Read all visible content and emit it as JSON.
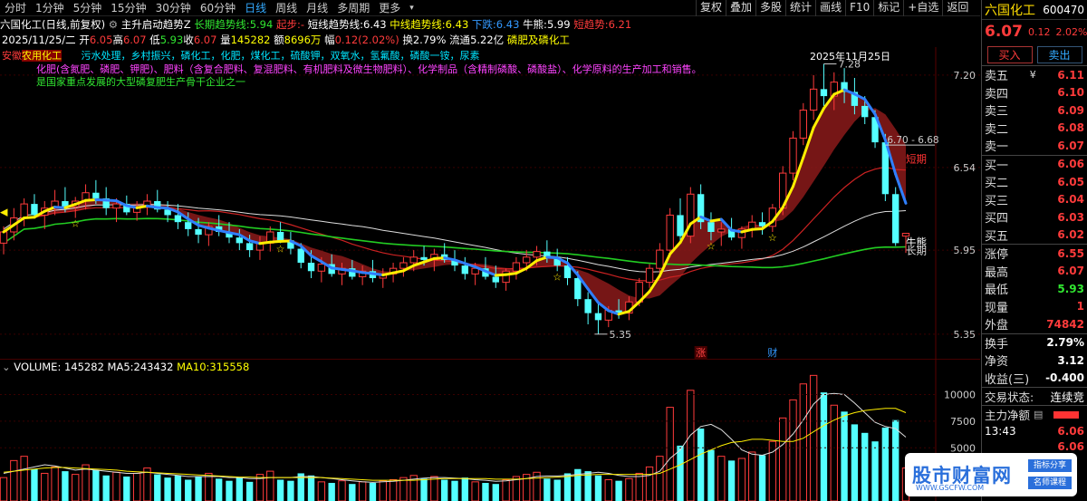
{
  "toolbar": {
    "periods": [
      "分时",
      "1分钟",
      "5分钟",
      "15分钟",
      "30分钟",
      "60分钟",
      "日线",
      "周线",
      "月线",
      "多周期",
      "更多"
    ],
    "selected_period": "日线",
    "right_buttons": [
      "复权",
      "叠加",
      "多股",
      "统计",
      "画线",
      "F10",
      "标记",
      "+自选",
      "返回"
    ]
  },
  "info1": {
    "stock": "六国化工(日线,前复权)",
    "indicator": "主升启动趋势Z",
    "long_trend_label": "长期趋势线:",
    "long_trend_val": "5.94",
    "start_label": "起步:",
    "start_val": "-",
    "short_trend_label": "短线趋势线:",
    "short_trend_val": "6.43",
    "mid_trend_label": "中线趋势线:",
    "mid_trend_val": "6.43",
    "down_label": "下跌:",
    "down_val": "6.43",
    "bull_label": "牛熊:",
    "bull_val": "5.99",
    "short_potential_label": "短趋势:",
    "short_potential_val": "6.21"
  },
  "info2": {
    "date": "2025/11/25/二",
    "open_label": "开",
    "open": "6.05",
    "high_label": "高",
    "high": "6.07",
    "low_label": "低",
    "low": "5.93",
    "close_label": "收",
    "close": "6.07",
    "vol_label": "量",
    "vol": "145282",
    "amount_label": "额",
    "amount": "8696万",
    "change_label": "幅",
    "change": "0.12(2.02%)",
    "turnover_label": "换",
    "turnover": "2.79%",
    "float_label": "流通",
    "float": "5.22亿",
    "sector": "磷肥及磷化工"
  },
  "info3": {
    "region": "安徽",
    "tag": "农用化工",
    "concepts": "污水处理，乡村振兴，磷化工，化肥，煤化工，硫酸钾，双氧水，氢氟酸，磷酸一铵，尿素",
    "business": "化肥(含氮肥、磷肥、钾肥)、肥料（含复合肥料、复混肥料、有机肥料及微生物肥料）、化学制品（含精制磷酸、磷酸盐）、化学原料的生产加工和销售。",
    "desc": "是国家重点发展的大型磷复肥生产骨干企业之一"
  },
  "chart_labels": {
    "date_marker": "2025年11月25日",
    "high_marker": "7.28",
    "low_marker": "5.35",
    "range_marker": "6.70 - 6.68",
    "short_label": "短期",
    "bull_label": "牛熊",
    "long_label": "长期",
    "event_zhang": "涨",
    "event_cai": "财"
  },
  "price_axis": [
    "7.20",
    "6.54",
    "5.95",
    "5.35"
  ],
  "volume_info": {
    "title": "VOLUME:",
    "volume": "145282",
    "ma5_label": "MA5:",
    "ma5": "243432",
    "ma10_label": "MA10:",
    "ma10": "315558"
  },
  "volume_axis": [
    "10000",
    "7500",
    "5000"
  ],
  "right_panel": {
    "name": "六国化工",
    "code": "600470",
    "price": "6.07",
    "change": "0.12",
    "change_pct": "2.02%",
    "buy_label": "买入",
    "sell_label": "卖出",
    "asks": [
      {
        "label": "卖五",
        "price": "6.11"
      },
      {
        "label": "卖四",
        "price": "6.10"
      },
      {
        "label": "卖三",
        "price": "6.09"
      },
      {
        "label": "卖二",
        "price": "6.08"
      },
      {
        "label": "卖一",
        "price": "6.07"
      }
    ],
    "ask_marker": "¥",
    "bids": [
      {
        "label": "买一",
        "price": "6.06"
      },
      {
        "label": "买二",
        "price": "6.05"
      },
      {
        "label": "买三",
        "price": "6.04"
      },
      {
        "label": "买四",
        "price": "6.03"
      },
      {
        "label": "买五",
        "price": "6.02"
      }
    ],
    "stats": [
      {
        "label": "涨停",
        "value": "6.55",
        "color": "red"
      },
      {
        "label": "最高",
        "value": "6.07",
        "color": "red"
      },
      {
        "label": "最低",
        "value": "5.93",
        "color": "green"
      },
      {
        "label": "现量",
        "value": "1",
        "color": "red"
      },
      {
        "label": "外盘",
        "value": "74842",
        "color": "red"
      }
    ],
    "stats2": [
      {
        "label": "换手",
        "value": "2.79%"
      },
      {
        "label": "净资",
        "value": "3.12"
      },
      {
        "label": "收益(三)",
        "value": "-0.400"
      }
    ],
    "trade_status_label": "交易状态:",
    "trade_status": "连续竞",
    "main_flow_label": "主力净额",
    "time": "13:43",
    "tick1": "6.06",
    "tick2": "6.06"
  },
  "watermark": {
    "main": "股市财富网",
    "sub": "WWW.GSCFW.COM",
    "tag1": "指标分享",
    "tag2": "名师课程"
  },
  "chart_data": {
    "type": "candlestick",
    "ylim": [
      5.2,
      7.4
    ],
    "candles": [
      [
        6.0,
        6.12,
        5.92,
        6.08
      ],
      [
        6.08,
        6.25,
        6.02,
        6.18
      ],
      [
        6.18,
        6.32,
        6.12,
        6.28
      ],
      [
        6.28,
        6.35,
        6.18,
        6.2
      ],
      [
        6.2,
        6.3,
        6.1,
        6.25
      ],
      [
        6.25,
        6.38,
        6.2,
        6.3
      ],
      [
        6.3,
        6.4,
        6.22,
        6.26
      ],
      [
        6.26,
        6.33,
        6.18,
        6.3
      ],
      [
        6.3,
        6.42,
        6.24,
        6.36
      ],
      [
        6.36,
        6.45,
        6.28,
        6.32
      ],
      [
        6.32,
        6.4,
        6.2,
        6.25
      ],
      [
        6.25,
        6.32,
        6.15,
        6.28
      ],
      [
        6.28,
        6.34,
        6.2,
        6.22
      ],
      [
        6.22,
        6.3,
        6.16,
        6.26
      ],
      [
        6.26,
        6.35,
        6.2,
        6.3
      ],
      [
        6.3,
        6.38,
        6.22,
        6.24
      ],
      [
        6.24,
        6.3,
        6.15,
        6.2
      ],
      [
        6.2,
        6.28,
        6.1,
        6.15
      ],
      [
        6.15,
        6.22,
        6.05,
        6.1
      ],
      [
        6.1,
        6.18,
        6.0,
        6.06
      ],
      [
        6.06,
        6.15,
        5.98,
        6.12
      ],
      [
        6.12,
        6.2,
        6.05,
        6.08
      ],
      [
        6.08,
        6.15,
        6.0,
        6.04
      ],
      [
        6.04,
        6.1,
        5.95,
        6.0
      ],
      [
        6.0,
        6.06,
        5.9,
        5.95
      ],
      [
        5.95,
        6.05,
        5.88,
        6.0
      ],
      [
        6.0,
        6.12,
        5.94,
        6.08
      ],
      [
        6.08,
        6.15,
        6.0,
        6.02
      ],
      [
        6.02,
        6.08,
        5.92,
        5.96
      ],
      [
        5.96,
        6.0,
        5.82,
        5.86
      ],
      [
        5.86,
        5.95,
        5.75,
        5.8
      ],
      [
        5.8,
        5.9,
        5.72,
        5.85
      ],
      [
        5.85,
        5.92,
        5.76,
        5.78
      ],
      [
        5.78,
        5.86,
        5.7,
        5.82
      ],
      [
        5.82,
        5.88,
        5.74,
        5.76
      ],
      [
        5.76,
        5.84,
        5.7,
        5.8
      ],
      [
        5.8,
        5.88,
        5.72,
        5.75
      ],
      [
        5.75,
        5.82,
        5.68,
        5.78
      ],
      [
        5.78,
        5.86,
        5.72,
        5.82
      ],
      [
        5.82,
        5.9,
        5.76,
        5.86
      ],
      [
        5.86,
        5.95,
        5.8,
        5.9
      ],
      [
        5.9,
        5.98,
        5.84,
        5.88
      ],
      [
        5.88,
        5.96,
        5.8,
        5.92
      ],
      [
        5.92,
        6.0,
        5.86,
        5.88
      ],
      [
        5.88,
        5.95,
        5.8,
        5.84
      ],
      [
        5.84,
        5.9,
        5.74,
        5.78
      ],
      [
        5.78,
        5.86,
        5.7,
        5.82
      ],
      [
        5.82,
        5.9,
        5.74,
        5.76
      ],
      [
        5.76,
        5.84,
        5.68,
        5.72
      ],
      [
        5.72,
        5.82,
        5.66,
        5.8
      ],
      [
        5.8,
        5.9,
        5.74,
        5.86
      ],
      [
        5.86,
        5.95,
        5.8,
        5.9
      ],
      [
        5.9,
        5.98,
        5.84,
        5.94
      ],
      [
        5.94,
        6.02,
        5.86,
        5.9
      ],
      [
        5.9,
        5.96,
        5.8,
        5.84
      ],
      [
        5.84,
        5.9,
        5.7,
        5.75
      ],
      [
        5.75,
        5.8,
        5.55,
        5.6
      ],
      [
        5.6,
        5.65,
        5.42,
        5.5
      ],
      [
        5.5,
        5.58,
        5.35,
        5.45
      ],
      [
        5.45,
        5.55,
        5.4,
        5.52
      ],
      [
        5.52,
        5.6,
        5.46,
        5.5
      ],
      [
        5.5,
        5.62,
        5.45,
        5.58
      ],
      [
        5.58,
        5.75,
        5.55,
        5.72
      ],
      [
        5.72,
        5.85,
        5.68,
        5.82
      ],
      [
        5.82,
        6.0,
        5.78,
        5.95
      ],
      [
        5.95,
        6.25,
        5.9,
        6.2
      ],
      [
        6.2,
        6.32,
        6.02,
        6.05
      ],
      [
        6.05,
        6.4,
        6.0,
        6.35
      ],
      [
        6.35,
        6.42,
        6.1,
        6.15
      ],
      [
        6.15,
        6.22,
        6.02,
        6.08
      ],
      [
        6.08,
        6.15,
        5.98,
        6.1
      ],
      [
        6.1,
        6.18,
        6.02,
        6.04
      ],
      [
        6.04,
        6.12,
        5.96,
        6.1
      ],
      [
        6.1,
        6.2,
        6.04,
        6.15
      ],
      [
        6.15,
        6.22,
        6.06,
        6.12
      ],
      [
        6.12,
        6.28,
        6.08,
        6.25
      ],
      [
        6.25,
        6.55,
        6.2,
        6.5
      ],
      [
        6.5,
        6.8,
        6.45,
        6.75
      ],
      [
        6.75,
        7.0,
        6.7,
        6.95
      ],
      [
        6.95,
        7.2,
        6.88,
        7.1
      ],
      [
        7.1,
        7.28,
        6.98,
        7.05
      ],
      [
        7.05,
        7.22,
        6.95,
        7.15
      ],
      [
        7.15,
        7.25,
        7.0,
        7.08
      ],
      [
        7.08,
        7.18,
        6.92,
        6.98
      ],
      [
        6.98,
        7.05,
        6.85,
        6.9
      ],
      [
        6.9,
        6.95,
        6.68,
        6.72
      ],
      [
        6.72,
        6.78,
        6.3,
        6.35
      ],
      [
        6.35,
        6.4,
        5.98,
        6.0
      ],
      [
        6.05,
        6.07,
        5.93,
        6.07
      ]
    ],
    "volume_ylim": [
      0,
      12000
    ],
    "volumes": [
      2200,
      3800,
      4200,
      3000,
      2600,
      3200,
      2800,
      2500,
      3400,
      2900,
      2400,
      2700,
      2300,
      2600,
      3100,
      2500,
      2200,
      2400,
      2000,
      2300,
      2600,
      2100,
      1900,
      2200,
      1800,
      2500,
      2800,
      2000,
      1900,
      2600,
      2400,
      1800,
      1700,
      1900,
      1600,
      1800,
      1700,
      1900,
      2000,
      2200,
      2400,
      2100,
      2300,
      2000,
      1900,
      2200,
      1800,
      1700,
      1600,
      2000,
      2300,
      2500,
      2700,
      2100,
      2000,
      2600,
      3000,
      2800,
      2400,
      2000,
      1900,
      2100,
      2600,
      3200,
      4200,
      8800,
      5200,
      10400,
      6800,
      4800,
      4200,
      3800,
      4000,
      4600,
      4300,
      5600,
      7800,
      9500,
      11000,
      11800,
      10200,
      9000,
      8400,
      7200,
      6400,
      5600,
      6900,
      7600,
      3100
    ],
    "ma5_line": [
      2600,
      2800,
      3000,
      3200,
      3400,
      3300,
      3100,
      2900,
      3000,
      2900,
      2800,
      2700,
      2600,
      2600,
      2700,
      2600,
      2500,
      2400,
      2300,
      2300,
      2300,
      2300,
      2200,
      2200,
      2100,
      2100,
      2200,
      2200,
      2200,
      2300,
      2300,
      2200,
      2100,
      2000,
      1900,
      1800,
      1750,
      1800,
      1850,
      1950,
      2050,
      2150,
      2200,
      2200,
      2150,
      2100,
      2000,
      1950,
      1850,
      1900,
      2000,
      2100,
      2300,
      2350,
      2350,
      2400,
      2500,
      2600,
      2700,
      2600,
      2400,
      2300,
      2300,
      2400,
      2800,
      4000,
      4800,
      6200,
      7000,
      7200,
      6700,
      5800,
      4800,
      4400,
      4300,
      4600,
      5300,
      6300,
      7600,
      9100,
      10000,
      10100,
      10000,
      9200,
      8300,
      7400,
      7000,
      6800,
      6000
    ],
    "ma10_line": [
      2700,
      2800,
      2900,
      3000,
      3100,
      3150,
      3150,
      3100,
      3050,
      3000,
      2950,
      2900,
      2800,
      2750,
      2700,
      2650,
      2600,
      2550,
      2500,
      2450,
      2400,
      2350,
      2300,
      2250,
      2250,
      2200,
      2200,
      2200,
      2200,
      2200,
      2200,
      2200,
      2150,
      2100,
      2050,
      2000,
      1950,
      1950,
      1950,
      1950,
      1950,
      2000,
      2050,
      2100,
      2100,
      2100,
      2100,
      2100,
      2050,
      2050,
      2050,
      2100,
      2150,
      2200,
      2250,
      2300,
      2400,
      2450,
      2500,
      2500,
      2500,
      2500,
      2500,
      2500,
      2600,
      3000,
      3400,
      3900,
      4400,
      4800,
      5200,
      5500,
      5600,
      5800,
      5800,
      5700,
      5600,
      5600,
      5900,
      6500,
      7100,
      7600,
      8000,
      8300,
      8500,
      8600,
      8700,
      8700,
      8300
    ]
  }
}
